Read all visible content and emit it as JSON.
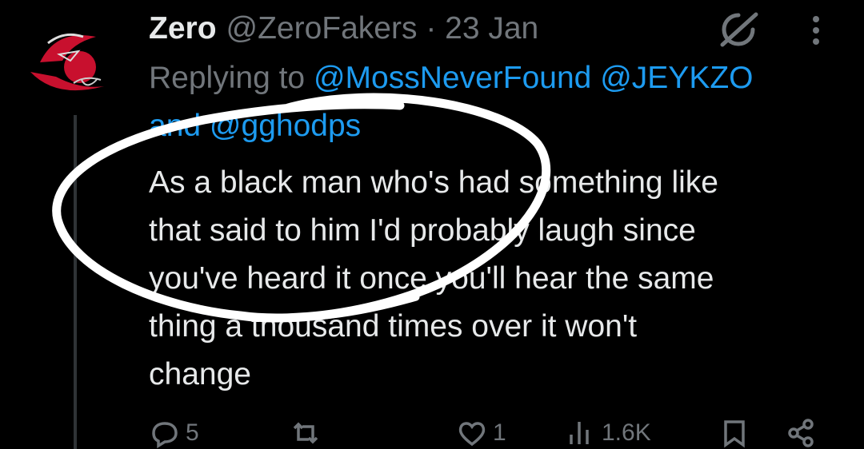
{
  "tweet": {
    "display_name": "Zero",
    "handle_date": "@ZeroFakers · 23 Jan",
    "replying_prefix": "Replying to",
    "mention_1": "@MossNeverFound",
    "mention_2": "@JEYKZO",
    "replying_and": "and",
    "mention_3": "@gghodps",
    "text_lines": [
      "As a black man who's had something like",
      "that said to him I'd probably laugh since",
      "you've heard it once you'll hear the same",
      "thing a thousand times over it won't",
      "change"
    ]
  },
  "actions": {
    "reply_count": "5",
    "retweet_count": "",
    "like_count": "1",
    "views_count": "1.6K"
  },
  "icons": {
    "grok": "grok-icon",
    "more": "more-vertical-icon",
    "reply": "reply-icon",
    "retweet": "retweet-icon",
    "like": "heart-icon",
    "views": "views-icon",
    "bookmark": "bookmark-icon",
    "share": "share-icon"
  },
  "colors": {
    "background": "#000000",
    "text": "#e7e9ea",
    "secondary": "#71767b",
    "link": "#1d9bf0",
    "annotation": "#ffffff"
  }
}
